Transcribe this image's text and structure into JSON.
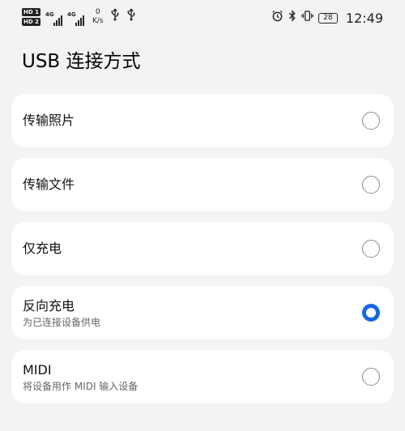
{
  "status_bar": {
    "sim1_label": "HD 1",
    "sim2_label": "HD 2",
    "network1": "4G",
    "network2": "4G",
    "speed_value": "0",
    "speed_unit": "K/s",
    "usb_icon_1": "usb-icon",
    "usb_icon_2": "usb-icon",
    "battery_level": "28",
    "time": "12:49"
  },
  "page": {
    "title": "USB 连接方式"
  },
  "options": [
    {
      "label": "传输照片",
      "subtitle": "",
      "selected": false
    },
    {
      "label": "传输文件",
      "subtitle": "",
      "selected": false
    },
    {
      "label": "仅充电",
      "subtitle": "",
      "selected": false
    },
    {
      "label": "反向充电",
      "subtitle": "为已连接设备供电",
      "selected": true
    },
    {
      "label": "MIDI",
      "subtitle": "将设备用作 MIDI 输入设备",
      "selected": false
    }
  ],
  "colors": {
    "accent": "#1668e3",
    "background": "#f1f3f5",
    "card": "#ffffff"
  }
}
